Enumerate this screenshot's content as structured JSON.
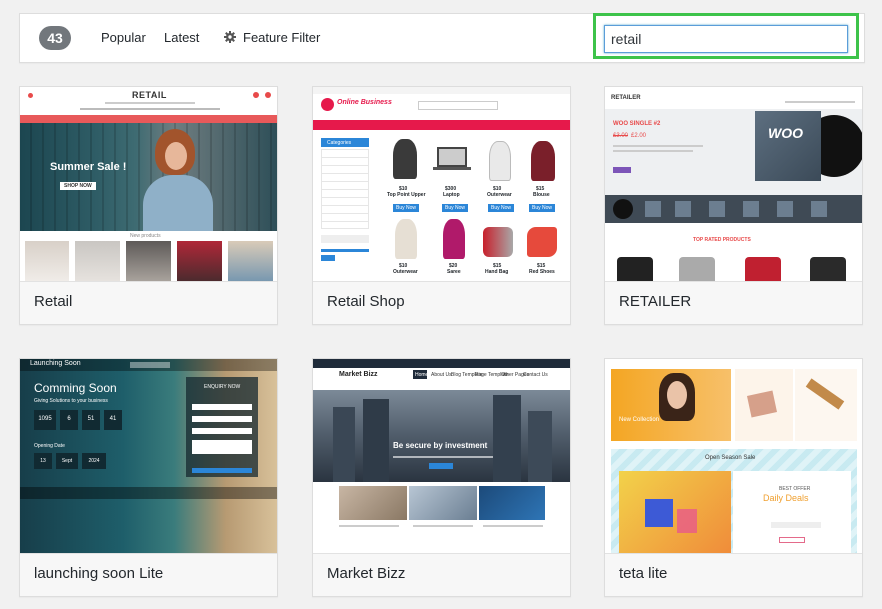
{
  "filter": {
    "count": "43",
    "popular": "Popular",
    "latest": "Latest",
    "feature_filter": "Feature Filter",
    "search_value": "retail"
  },
  "colors": {
    "search_highlight": "#3dc34a",
    "count_badge": "#72777c",
    "retail_accent": "#e84a4a",
    "online_business_pink": "#e6194b"
  },
  "themes": [
    {
      "name": "Retail",
      "preview": {
        "logo": "RETAIL",
        "sale_text": "Summer Sale !",
        "button": "SHOP NOW",
        "section": "New products"
      }
    },
    {
      "name": "Retail Shop",
      "preview": {
        "logo": "Online Business",
        "menu_title": "Categories",
        "products": [
          {
            "title": "Top Point Upper",
            "price": "$10"
          },
          {
            "title": "Laptop",
            "price": "$300"
          },
          {
            "title": "Outerwear",
            "price": "$10"
          },
          {
            "title": "Blouse",
            "price": "$15"
          },
          {
            "title": "Outerwear",
            "price": "$10"
          },
          {
            "title": "Saree",
            "price": "$20"
          },
          {
            "title": "Hand Bag",
            "price": "$15"
          },
          {
            "title": "Red Shoes",
            "price": "$15"
          }
        ],
        "buy_label": "Buy Now"
      }
    },
    {
      "name": "RETAILER",
      "preview": {
        "logo": "RETAILER",
        "product_title": "WOO SINGLE #2",
        "old_price": "£3.00",
        "price": "£2.00",
        "cover_text": "WOO",
        "section": "TOP RATED PRODUCTS"
      }
    },
    {
      "name": "launching soon Lite",
      "preview": {
        "brand": "Launching Soon",
        "headline": "Comming Soon",
        "subhead": "Giving Solutions to your business",
        "countdown": [
          "1095",
          "6",
          "51",
          "41"
        ],
        "opening_label": "Opening Date",
        "date": [
          "13",
          "Sept",
          "2024"
        ],
        "enquiry": "ENQUIRY NOW"
      }
    },
    {
      "name": "Market Bizz",
      "preview": {
        "brand": "Market Bizz",
        "menu": [
          "Home",
          "About Us",
          "Blog Template",
          "Page Template",
          "Other Pages",
          "Contact Us"
        ],
        "headline": "Be secure by investment"
      }
    },
    {
      "name": "teta lite",
      "preview": {
        "banner": "New Collection",
        "sale_label": "Open Season Sale",
        "offer": "BEST OFFER",
        "deals": "Daily Deals"
      }
    }
  ]
}
